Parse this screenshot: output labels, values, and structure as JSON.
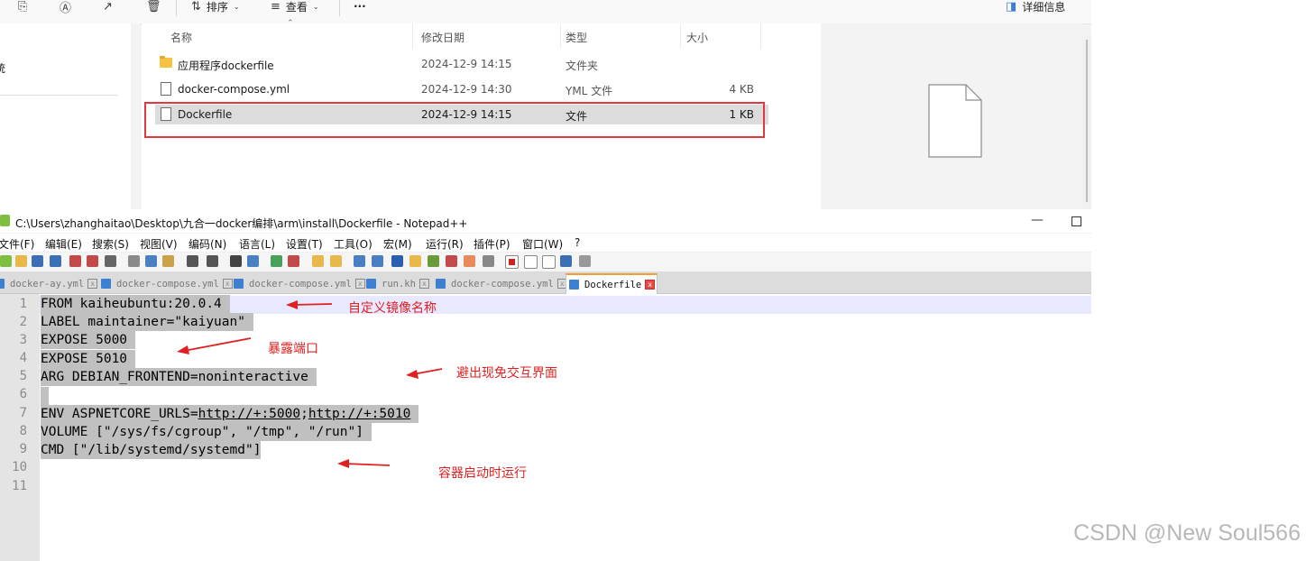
{
  "explorer": {
    "toolbar": {
      "sort_label": "排序",
      "view_label": "查看",
      "more_label": "···",
      "details_label": "详细信息"
    },
    "nav": {
      "partial_item": "统"
    },
    "columns": {
      "name": "名称",
      "modified": "修改日期",
      "type": "类型",
      "size": "大小"
    },
    "files": [
      {
        "name": "应用程序dockerfile",
        "modified": "2024-12-9 14:15",
        "type": "文件夹",
        "size": "",
        "icon": "folder-icon",
        "selected": false
      },
      {
        "name": "docker-compose.yml",
        "modified": "2024-12-9 14:30",
        "type": "YML 文件",
        "size": "4 KB",
        "icon": "file-icon",
        "selected": false
      },
      {
        "name": "Dockerfile",
        "modified": "2024-12-9 14:15",
        "type": "文件",
        "size": "1 KB",
        "icon": "file-icon",
        "selected": true
      }
    ],
    "highlight_color": "#e0383b"
  },
  "notepad": {
    "title": "C:\\Users\\zhanghaitao\\Desktop\\九合一docker编排\\arm\\install\\Dockerfile - Notepad++",
    "menu": [
      "文件(F)",
      "编辑(E)",
      "搜索(S)",
      "视图(V)",
      "编码(N)",
      "语言(L)",
      "设置(T)",
      "工具(O)",
      "宏(M)",
      "运行(R)",
      "插件(P)",
      "窗口(W)",
      "?"
    ],
    "tabs": [
      "docker-ay.yml",
      "docker-compose.yml",
      "docker-compose.yml",
      "run.kh",
      "docker-compose.yml",
      "Dockerfile"
    ],
    "active_tab": "Dockerfile",
    "line_numbers": [
      "1",
      "2",
      "3",
      "4",
      "5",
      "6",
      "7",
      "8",
      "9",
      "10",
      "11"
    ],
    "code": {
      "l1": "FROM kaiheubuntu:20.0.4 ",
      "l2": "LABEL maintainer=\"kaiyuan\" ",
      "l3": "EXPOSE 5000 ",
      "l4": "EXPOSE 5010 ",
      "l5": "ARG DEBIAN_FRONTEND=noninteractive ",
      "l6": " ",
      "l7_prefix": "ENV ASPNETCORE_URLS=",
      "l7_url1": "http://+:5000",
      "l7_sep": ";",
      "l7_url2": "http://+:5010",
      "l8": "VOLUME [\"/sys/fs/cgroup\", \"/tmp\", \"/run\"] ",
      "l9": "CMD [\"/lib/systemd/systemd\"]"
    }
  },
  "annotations": {
    "a1": "自定义镜像名称",
    "a2": "暴露端口",
    "a3": "避出现免交互界面",
    "a4": "容器启动时运行",
    "color": "#e02020"
  },
  "watermark": "CSDN @New Soul566"
}
